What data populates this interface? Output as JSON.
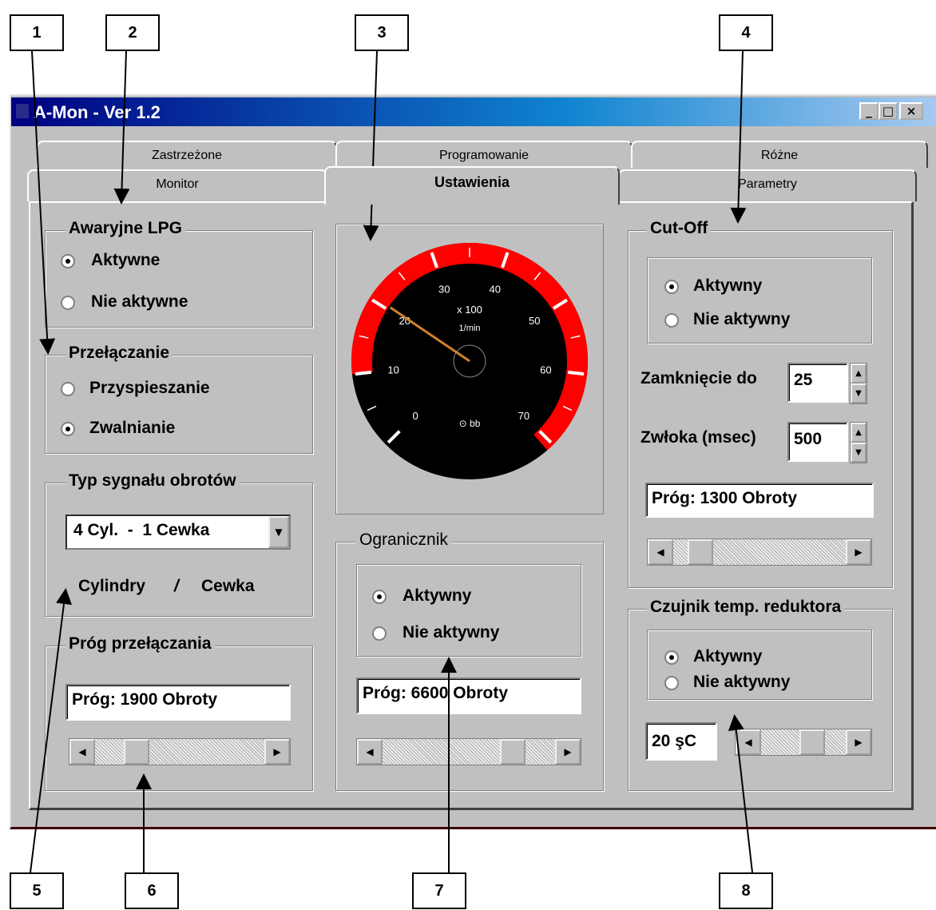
{
  "callouts": [
    "1",
    "2",
    "3",
    "4",
    "5",
    "6",
    "7",
    "8"
  ],
  "window": {
    "title": "A-Mon - Ver 1.2",
    "controls": [
      "minimize-icon",
      "maximize-icon",
      "close-icon"
    ],
    "titlebar_colors": [
      "#000080",
      "#1084d0"
    ]
  },
  "tabs": {
    "row_back": [
      "Zastrzeżone",
      "Programowanie",
      "Różne"
    ],
    "row_front": [
      "Monitor",
      "Ustawienia",
      "Parametry"
    ],
    "active": "Ustawienia"
  },
  "awaryjne": {
    "title": "Awaryjne LPG",
    "options": [
      "Aktywne",
      "Nie aktywne"
    ],
    "selected": "Aktywne"
  },
  "przelaczanie": {
    "title": "Przełączanie",
    "options": [
      "Przyspieszanie",
      "Zwalnianie"
    ],
    "selected": "Zwalnianie"
  },
  "typ_sygnalu": {
    "title": "Typ sygnału obrotów",
    "combo_value": "4 Cyl.  -  1 Cewka",
    "caption_left": "Cylindry",
    "caption_sep": "/",
    "caption_right": "Cewka"
  },
  "prog_przelaczania": {
    "title": "Próg przełączania",
    "value": "Próg: 1900 Obroty",
    "slider_fraction": 0.2
  },
  "gauge": {
    "unit_line1": "x 100",
    "unit_line2": "1/min",
    "brand": "⊙ bb",
    "ticks": [
      "0",
      "10",
      "20",
      "30",
      "40",
      "50",
      "60",
      "70"
    ],
    "needle_value": 20.5,
    "red_zone_color": "#ff0000"
  },
  "ogranicznik": {
    "title": "Ogranicznik",
    "options": [
      "Aktywny",
      "Nie aktywny"
    ],
    "selected": "Aktywny",
    "value": "Próg: 6600 Obroty",
    "slider_fraction": 0.8
  },
  "cutoff": {
    "title": "Cut-Off",
    "options": [
      "Aktywny",
      "Nie aktywny"
    ],
    "selected": "Aktywny",
    "zamkniecie_label": "Zamknięcie do",
    "zamkniecie_value": "25",
    "zwloka_label": "Zwłoka (msec)",
    "zwloka_value": "500",
    "value": "Próg: 1300 Obroty",
    "slider_fraction": 0.1
  },
  "czujnik": {
    "title": "Czujnik temp. reduktora",
    "options": [
      "Aktywny",
      "Nie aktywny"
    ],
    "selected": "Aktywny",
    "temp_value": "20 şC",
    "slider_fraction": 0.65
  }
}
